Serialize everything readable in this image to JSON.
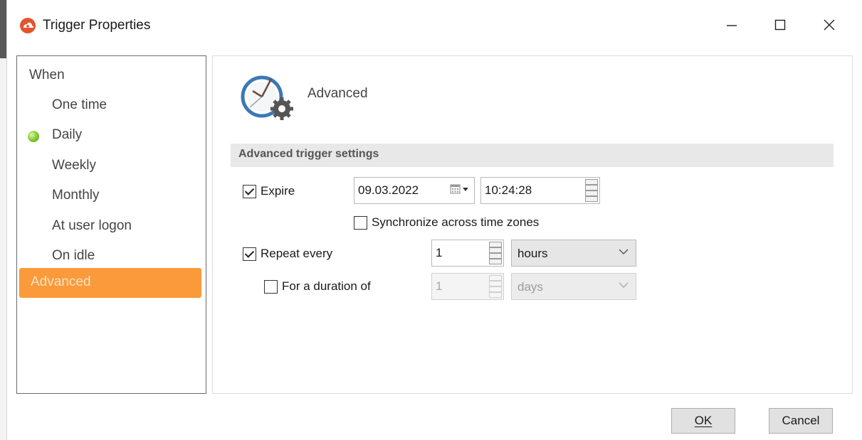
{
  "window": {
    "title": "Trigger Properties"
  },
  "nav": {
    "heading": "When",
    "items": [
      {
        "label": "One time"
      },
      {
        "label": "Daily",
        "active_indicator": "green-dot"
      },
      {
        "label": "Weekly"
      },
      {
        "label": "Monthly"
      },
      {
        "label": "At user logon"
      },
      {
        "label": "On idle"
      },
      {
        "label": "Advanced",
        "selected": true
      }
    ]
  },
  "content": {
    "title": "Advanced",
    "section_header": "Advanced trigger settings",
    "expire": {
      "label": "Expire",
      "checked": true,
      "date": "09.03.2022",
      "time": "10:24:28"
    },
    "sync": {
      "label": "Synchronize across time zones",
      "checked": false
    },
    "repeat": {
      "label": "Repeat every",
      "checked": true,
      "value": "1",
      "unit": "hours"
    },
    "duration": {
      "label": "For a duration of",
      "checked": false,
      "value": "1",
      "unit": "days",
      "disabled": true
    }
  },
  "buttons": {
    "ok": "OK",
    "cancel": "Cancel"
  },
  "colors": {
    "selected_nav": "#fb9a3a",
    "app_icon": "#e4532c",
    "clock_ring": "#3c78b6"
  }
}
